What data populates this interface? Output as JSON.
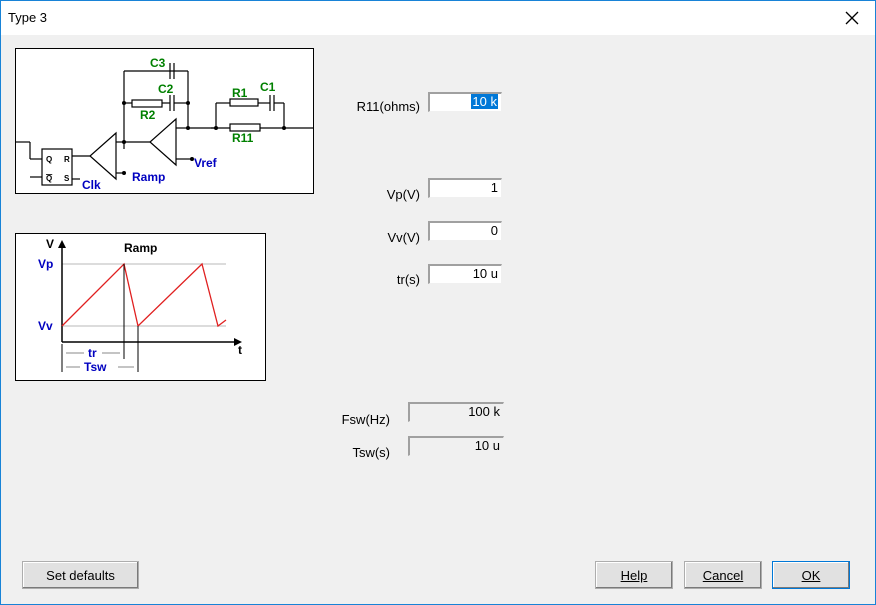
{
  "window": {
    "title": "Type 3"
  },
  "schematic": {
    "labels": {
      "c3": "C3",
      "c2": "C2",
      "r2": "R2",
      "r1": "R1",
      "c1": "C1",
      "r11": "R11",
      "vref": "Vref",
      "ramp": "Ramp",
      "clk": "Clk",
      "q": "Q",
      "r": "R",
      "qbar": "Q",
      "s": "S"
    }
  },
  "ramp_diagram": {
    "title": "Ramp",
    "v_axis": "V",
    "t_axis": "t",
    "vp": "Vp",
    "vv": "Vv",
    "tr": "tr",
    "tsw": "Tsw"
  },
  "fields": {
    "r11": {
      "label": "R11(ohms)",
      "value": "10 k"
    },
    "vp": {
      "label": "Vp(V)",
      "value": "1"
    },
    "vv": {
      "label": "Vv(V)",
      "value": "0"
    },
    "tr": {
      "label": "tr(s)",
      "value": "10 u"
    },
    "fsw": {
      "label": "Fsw(Hz)",
      "value": "100 k"
    },
    "tsw": {
      "label": "Tsw(s)",
      "value": "10 u"
    }
  },
  "buttons": {
    "set_defaults": "Set defaults",
    "help": "Help",
    "cancel": "Cancel",
    "ok": "OK"
  },
  "colors": {
    "green": "#008000",
    "blue": "#0000c0",
    "red": "#e02020",
    "accent": "#1883d7"
  }
}
